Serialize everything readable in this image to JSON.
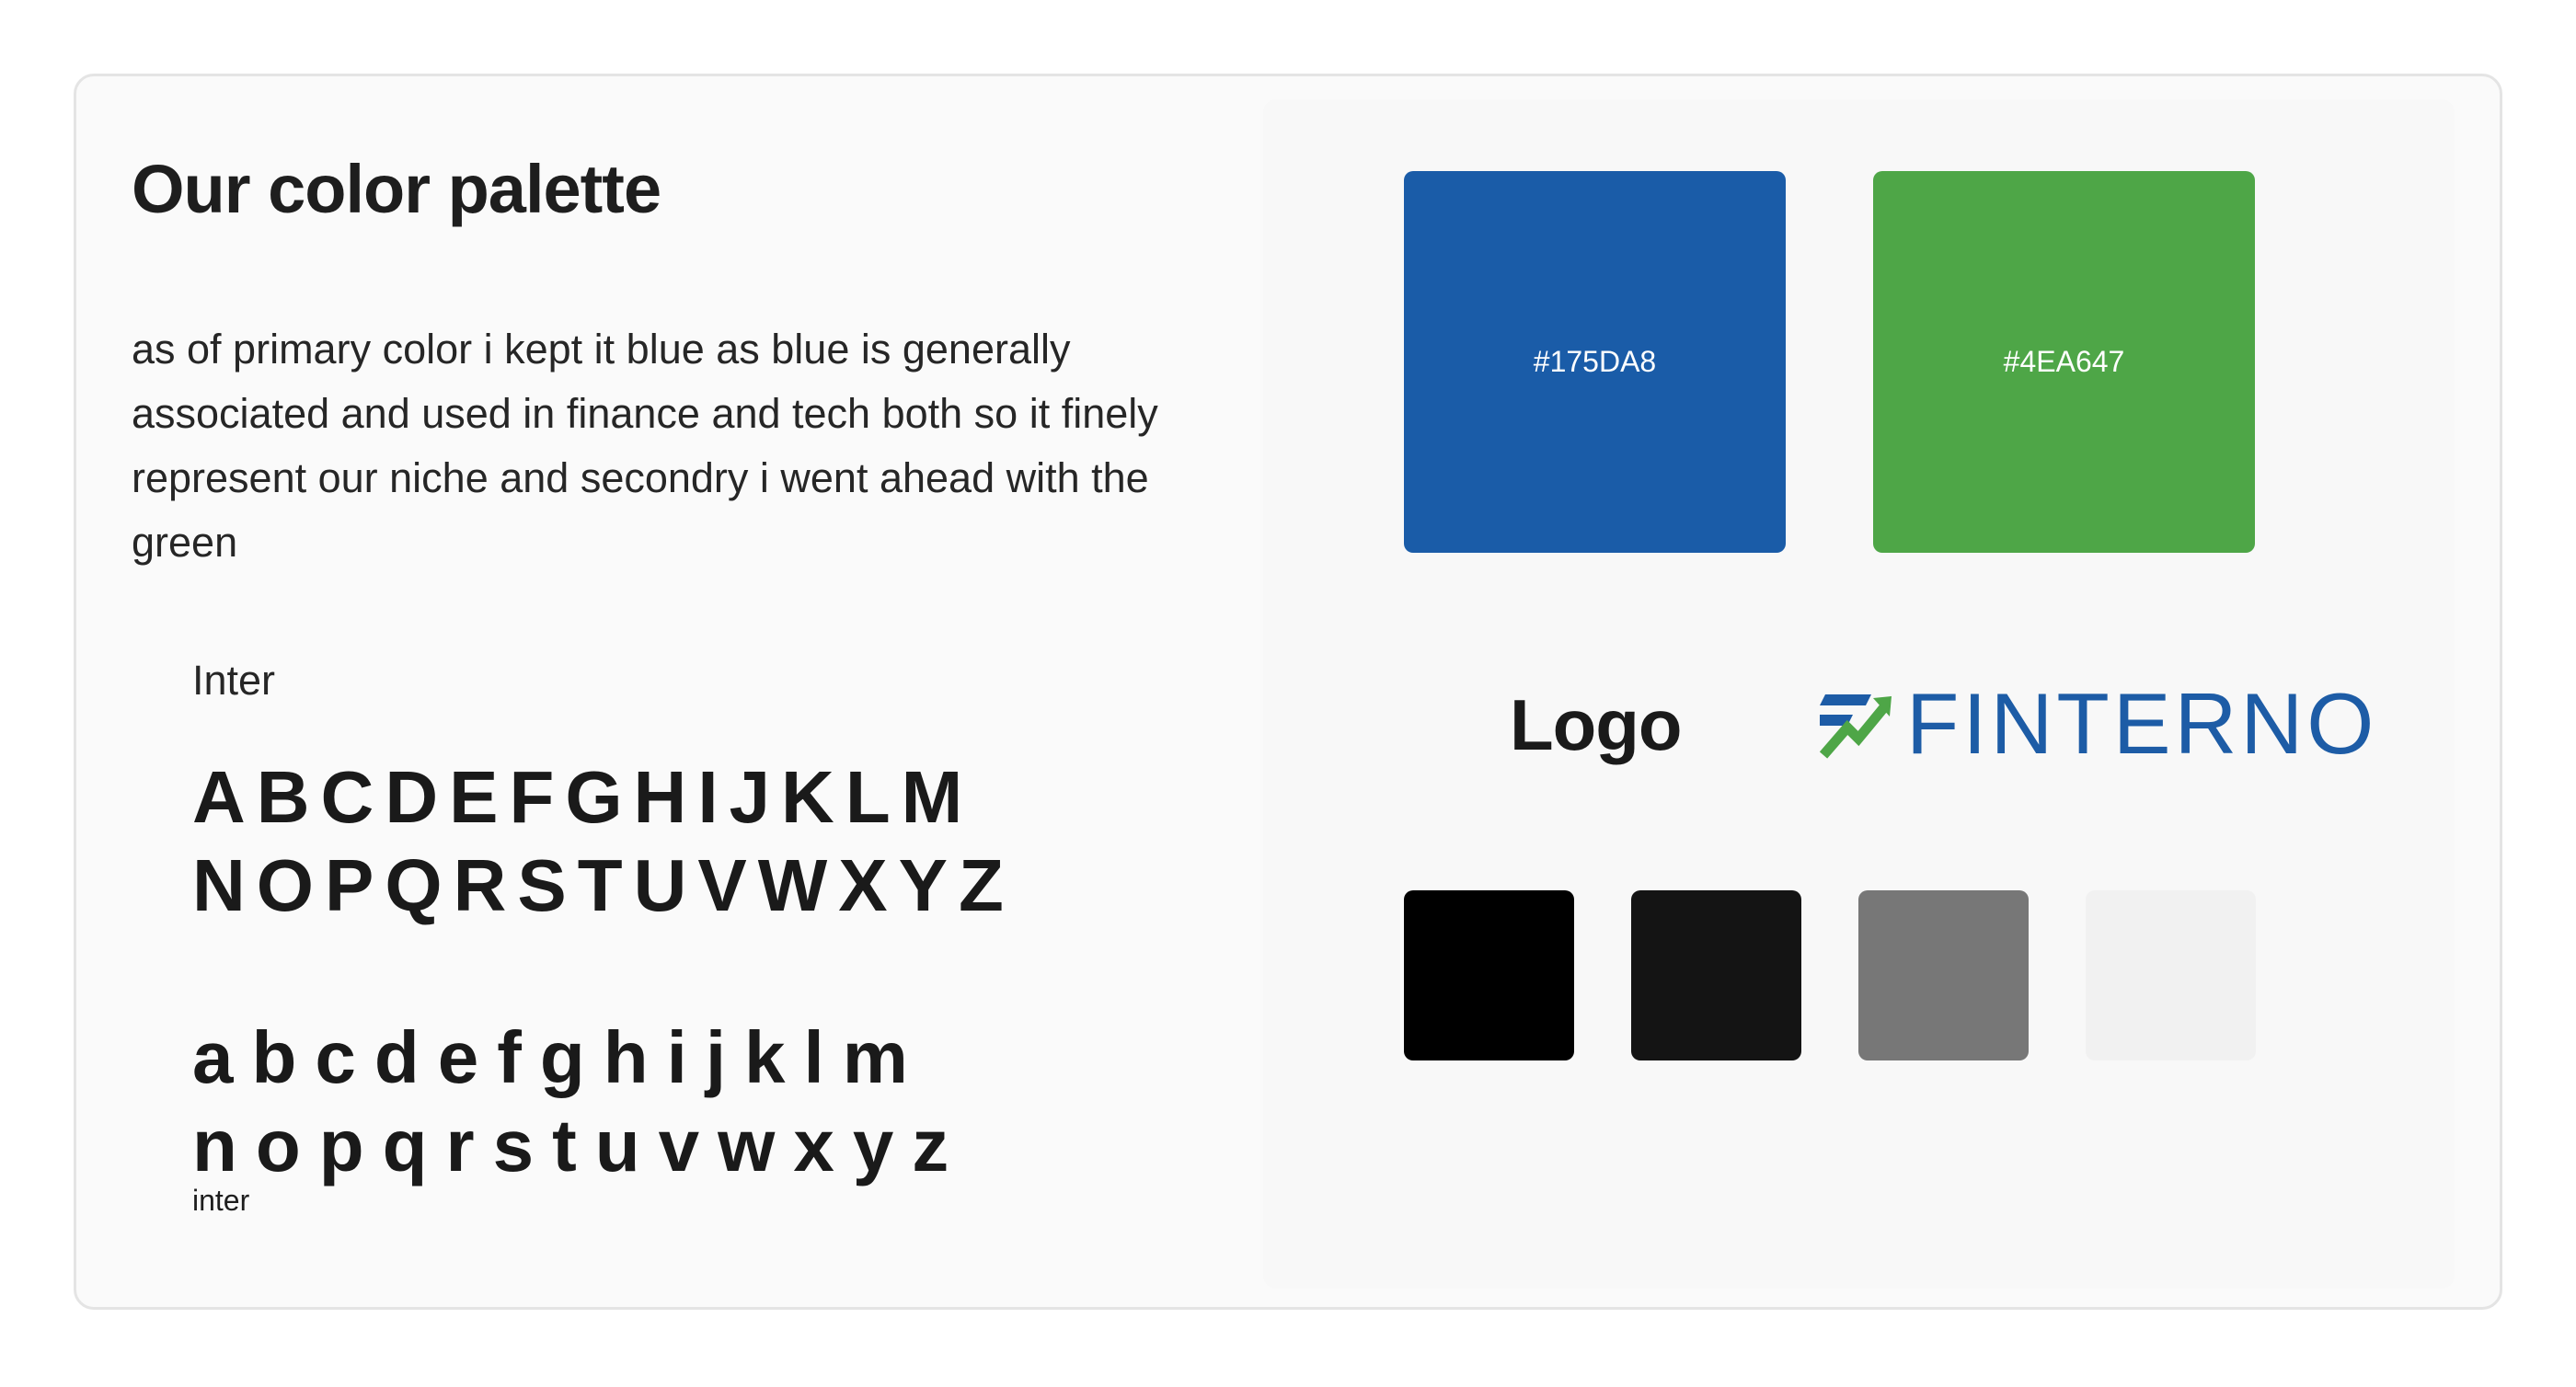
{
  "header": {
    "title": "Our color palette"
  },
  "intro": {
    "text": "as of primary color i kept it blue as blue is generally associated and used in finance and tech both so it finely represent our niche and secondry i went ahead with the green"
  },
  "typography": {
    "font_name": "Inter",
    "uppercase_line1": "ABCDEFGHIJKLM",
    "uppercase_line2": "NOPQRSTUVWXYZ",
    "lowercase_line1": "abcdefghijklm",
    "lowercase_line2": "nopqrstuvwxyz",
    "caption": "inter"
  },
  "palette": {
    "primary": {
      "code": "#175DA8",
      "color": "#1a5ca8"
    },
    "secondary": {
      "code": "#4EA647",
      "color": "#4ea647"
    },
    "neutrals": [
      {
        "name": "black",
        "color": "#000000"
      },
      {
        "name": "near-black",
        "color": "#141414"
      },
      {
        "name": "gray",
        "color": "#777777"
      },
      {
        "name": "light-gray",
        "color": "#f1f1f1"
      }
    ]
  },
  "logo": {
    "label": "Logo",
    "wordmark": "FINTERNO",
    "wordmark_color": "#1d5ca6",
    "icon": "finterno-arrow-icon",
    "icon_colors": {
      "blue": "#1d5ca6",
      "green": "#4ea647"
    }
  }
}
